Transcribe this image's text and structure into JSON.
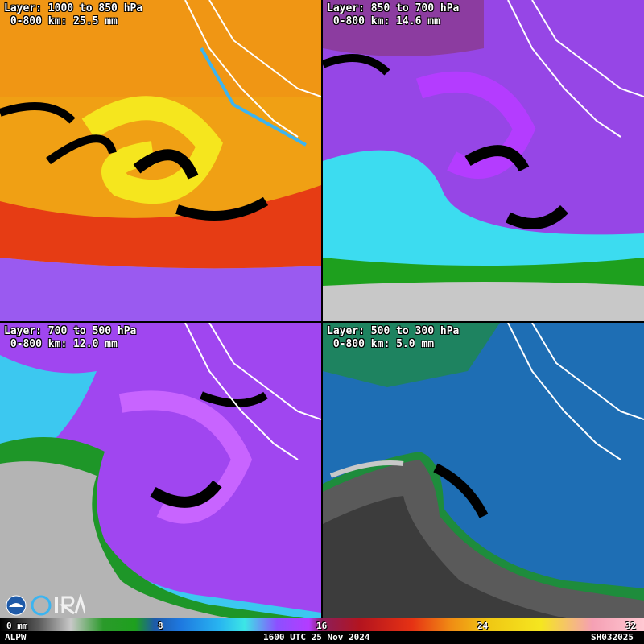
{
  "panels": [
    {
      "layer": "Layer: 1000 to 850 hPa",
      "stat": " 0-800 km: 25.5 mm"
    },
    {
      "layer": "Layer: 850 to 700 hPa",
      "stat": " 0-800 km: 14.6 mm"
    },
    {
      "layer": "Layer: 700 to 500 hPa",
      "stat": " 0-800 km: 12.0 mm"
    },
    {
      "layer": "Layer: 500 to 300 hPa",
      "stat": " 0-800 km: 5.0 mm"
    }
  ],
  "colorbar": {
    "ticks": [
      "0 mm",
      "8",
      "16",
      "24",
      "32"
    ]
  },
  "footer": {
    "product": "ALPW",
    "time": "1600 UTC 25 Nov 2024",
    "id": "SH032025"
  },
  "colors": {
    "panel1": [
      "#f5a014",
      "#f5e61e",
      "#e63214",
      "#8c50ff"
    ],
    "panel2": [
      "#9646e6",
      "#3cdcf0",
      "#1ea01e",
      "#c8c8c8"
    ],
    "panel3": [
      "#a046f0",
      "#3cc8f0",
      "#1e9628",
      "#b4b4b4"
    ],
    "panel4": [
      "#1e6eb4",
      "#1e8c3c",
      "#5a5a5a",
      "#a0a0a0"
    ]
  }
}
